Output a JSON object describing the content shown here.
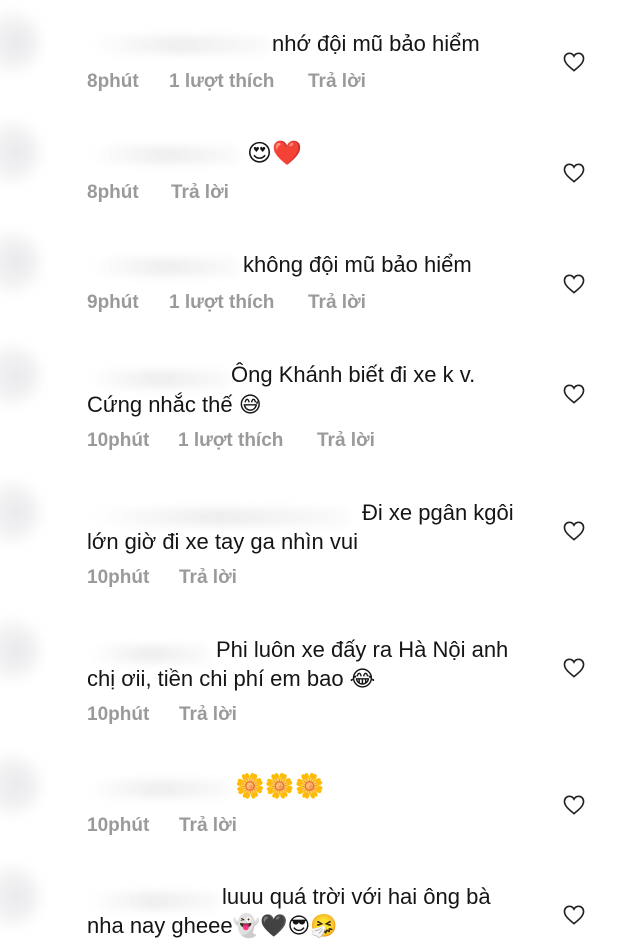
{
  "comments": [
    {
      "text": "nhớ đội mũ bảo hiểm",
      "time": "8phút",
      "likes": "1 lượt thích",
      "reply": "Trả lời"
    },
    {
      "text": "😍❤️",
      "time": "8phút",
      "likes": "",
      "reply": "Trả lời"
    },
    {
      "text": "không đội mũ bảo hiểm",
      "time": "9phút",
      "likes": "1 lượt thích",
      "reply": "Trả lời"
    },
    {
      "text_line1": "Ông Khánh biết đi xe k v.",
      "text_line2": "Cứng nhắc thế 😅",
      "time": "10phút",
      "likes": "1 lượt thích",
      "reply": "Trả lời"
    },
    {
      "text_line1": "Đi xe pgân kgôi",
      "text_line2": "lớn giờ đi xe tay ga nhìn vui",
      "time": "10phút",
      "likes": "",
      "reply": "Trả lời"
    },
    {
      "text_line1": "Phi luôn xe đấy ra Hà Nội anh",
      "text_line2": "chị ơii, tiền chi phí em bao 😂",
      "time": "10phút",
      "likes": "",
      "reply": "Trả lời"
    },
    {
      "text": "🌼🌼🌼",
      "time": "10phút",
      "likes": "",
      "reply": "Trả lời"
    },
    {
      "text_line1": "luuu quá trời với hai ông bà",
      "text_line2": "nha nay gheee👻🖤😎🤧",
      "time": "",
      "likes": "",
      "reply": ""
    }
  ],
  "icons": {
    "like": "heart-outline-icon"
  },
  "colors": {
    "text": "#151515",
    "meta": "#9a9a9a",
    "heart_stroke": "#222222"
  }
}
